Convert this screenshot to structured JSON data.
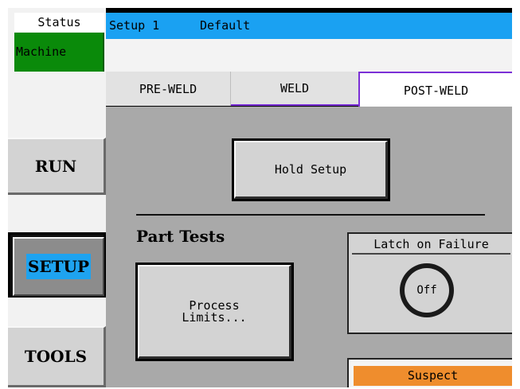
{
  "status": {
    "label": "Status",
    "value": "Machine"
  },
  "header": {
    "setup": "Setup 1",
    "preset": "Default"
  },
  "nav": {
    "run": "RUN",
    "setup": "SETUP",
    "tools": "TOOLS",
    "active": "SETUP"
  },
  "tabs": {
    "pre_weld": "PRE-WELD",
    "weld": "WELD",
    "post_weld": "POST-WELD",
    "active": "POST-WELD"
  },
  "main": {
    "hold_setup": "Hold Setup",
    "section_title": "Part Tests",
    "process_limits_line1": "Process",
    "process_limits_line2": "Limits...",
    "latch_title": "Latch on Failure",
    "latch_value": "Off",
    "suspect": "Suspect"
  },
  "colors": {
    "status_green": "#0a8a0a",
    "header_blue": "#1aa1f2",
    "panel_gray": "#a9a9a9",
    "tab_accent": "#7b2fd6",
    "suspect_orange": "#ef8d2d"
  }
}
